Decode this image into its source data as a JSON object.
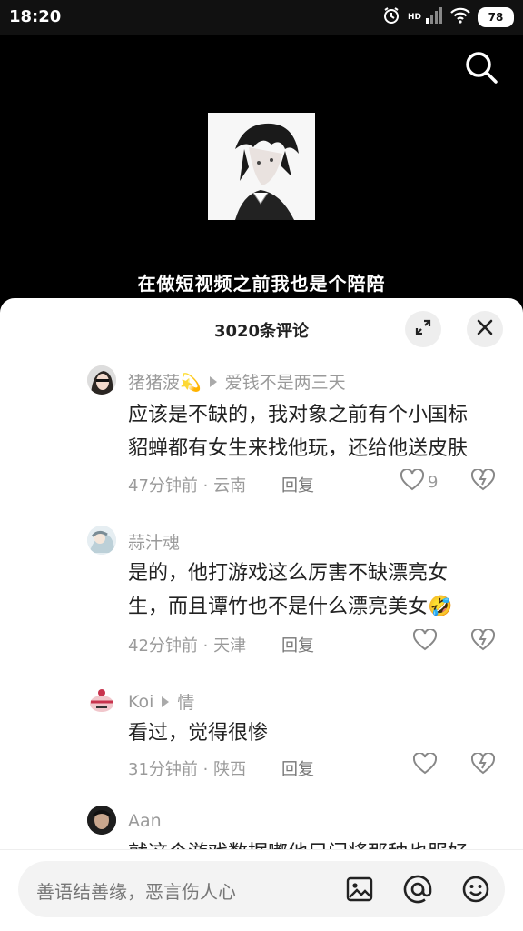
{
  "status": {
    "time": "18:20",
    "network": "HD",
    "battery": "78"
  },
  "video": {
    "subtitle": "在做短视频之前我也是个陪陪"
  },
  "sheet": {
    "title": "3020条评论",
    "comments": [
      {
        "username": "猪猪菠💫",
        "reply_to": "爱钱不是两三天",
        "text_lines": [
          "应该是不缺的，我对象之前有个小国标",
          "貂蝉都有女生来找他玩，还给他送皮肤"
        ],
        "time_loc": "47分钟前 · 云南",
        "reply": "回复",
        "likes": "9"
      },
      {
        "username": "蒜汁魂",
        "reply_to": "",
        "text_lines": [
          "是的，他打游戏这么厉害不缺漂亮女",
          "生，而且谭竹也不是什么漂亮美女🤣"
        ],
        "time_loc": "42分钟前 · 天津",
        "reply": "回复",
        "likes": ""
      },
      {
        "username": "Koi",
        "reply_to": "情",
        "text_lines": [
          "看过，觉得很惨"
        ],
        "time_loc": "31分钟前 · 陕西",
        "reply": "回复",
        "likes": ""
      },
      {
        "username": "Aan",
        "reply_to": "",
        "text_lines": [
          "就这个游戏数据嘟他兄门将那种也服好"
        ],
        "time_loc": "",
        "reply": "",
        "likes": ""
      }
    ]
  },
  "input": {
    "placeholder": "善语结善缘，恶言伤人心"
  }
}
